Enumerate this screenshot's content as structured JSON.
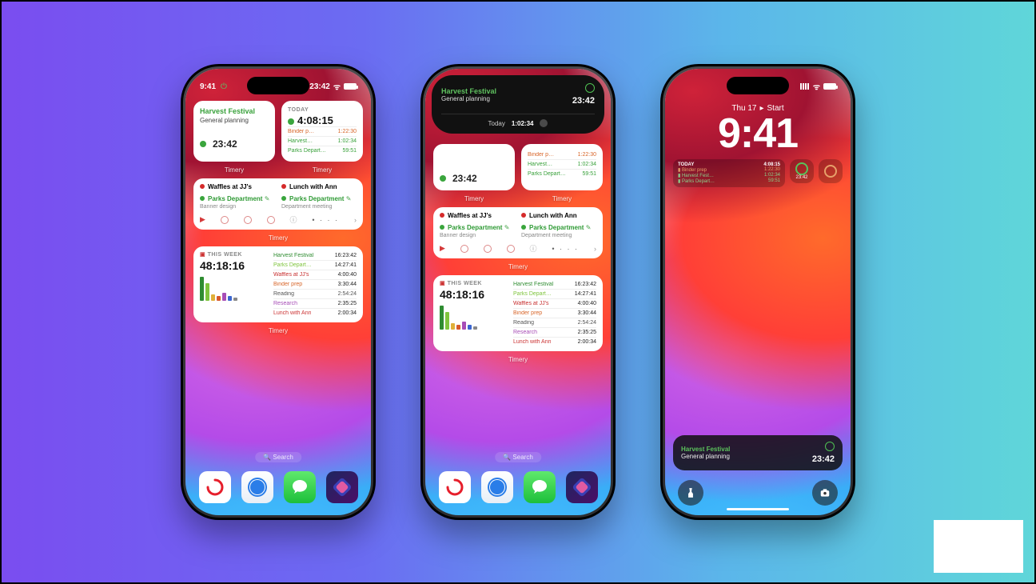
{
  "status": {
    "time": "9:41",
    "island_time": "23:42"
  },
  "app_label": "Timery",
  "search_label": "Search",
  "widgets": {
    "current": {
      "title": "Harvest Festival",
      "subtitle": "General planning",
      "elapsed": "23:42"
    },
    "today": {
      "label": "TODAY",
      "total": "4:08:15",
      "items": [
        {
          "name": "Binder p…",
          "time": "1:22:30"
        },
        {
          "name": "Harvest…",
          "time": "1:02:34"
        },
        {
          "name": "Parks Department",
          "time": "59:51"
        }
      ]
    },
    "saved": {
      "left": {
        "top": "Waffles at JJ's",
        "title": "Parks Department",
        "sub": "Banner design"
      },
      "right": {
        "top": "Lunch with Ann",
        "title": "Parks Department",
        "sub": "Department meeting"
      }
    },
    "week": {
      "label": "THIS WEEK",
      "total": "48:18:16",
      "list": [
        {
          "name": "Harvest Festival",
          "time": "16:23:42"
        },
        {
          "name": "Parks Departmen…",
          "time": "14:27:41"
        },
        {
          "name": "Waffles at JJ's",
          "time": "4:00:40"
        },
        {
          "name": "Binder prep",
          "time": "3:30:44"
        },
        {
          "name": "Reading",
          "time": "2:54:24"
        },
        {
          "name": "Research",
          "time": "2:35:25"
        },
        {
          "name": "Lunch with Ann",
          "time": "2:00:34"
        }
      ]
    }
  },
  "island_expanded": {
    "title": "Harvest Festival",
    "subtitle": "General planning",
    "elapsed": "23:42",
    "footer_label": "Today",
    "footer_time": "1:02:34"
  },
  "lockscreen": {
    "date": "Thu 17",
    "start_label": "Start",
    "time": "9:41",
    "today_label": "TODAY",
    "today_total": "4:08:15",
    "mini_items": [
      {
        "name": "Binder prep",
        "time": "1:22:30"
      },
      {
        "name": "Harvest Fest…",
        "time": "1:02:34"
      },
      {
        "name": "Parks Depart…",
        "time": "59:51"
      }
    ],
    "circ_time": "23:42",
    "notif": {
      "title": "Harvest Festival",
      "sub": "General planning",
      "elapsed": "23:42"
    }
  },
  "dock": [
    {
      "name": "Timery"
    },
    {
      "name": "Safari"
    },
    {
      "name": "Messages"
    },
    {
      "name": "Shortcuts"
    }
  ],
  "chart_data": {
    "type": "bar",
    "title": "This Week",
    "categories": [
      "Harvest Festival",
      "Parks Department",
      "Waffles at JJ's",
      "Binder prep",
      "Reading",
      "Research",
      "Lunch with Ann"
    ],
    "values_hms": [
      "16:23:42",
      "14:27:41",
      "4:00:40",
      "3:30:44",
      "2:54:24",
      "2:35:25",
      "2:00:34"
    ],
    "total": "48:18:16"
  }
}
